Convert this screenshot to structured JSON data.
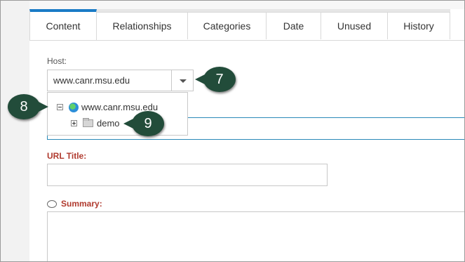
{
  "tabs": [
    {
      "label": "Content",
      "active": true
    },
    {
      "label": "Relationships"
    },
    {
      "label": "Categories"
    },
    {
      "label": "Date"
    },
    {
      "label": "Unused"
    },
    {
      "label": "History"
    }
  ],
  "host": {
    "label": "Host:",
    "value": "www.canr.msu.edu"
  },
  "tree": {
    "root": "www.canr.msu.edu",
    "child": "demo"
  },
  "url_title": {
    "label": "URL Title:"
  },
  "summary": {
    "label": "Summary:"
  },
  "callouts": {
    "c7": "7",
    "c8": "8",
    "c9": "9"
  },
  "colors": {
    "accent": "#1a7bc6",
    "required_label": "#b03a2e",
    "callout": "#224c3a"
  }
}
